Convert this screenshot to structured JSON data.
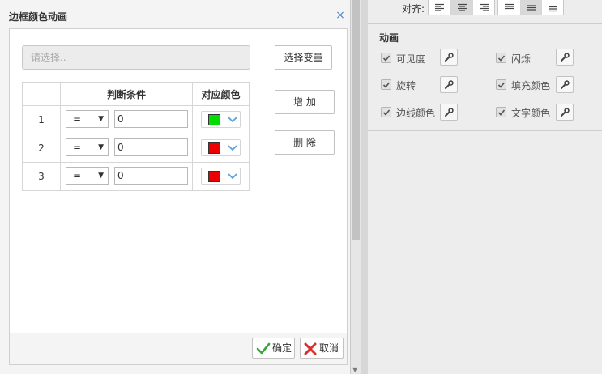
{
  "dialog": {
    "title": "边框颜色动画",
    "close_glyph": "×",
    "variable_placeholder": "请选择..",
    "select_variable_label": "选择变量",
    "add_label": "增 加",
    "delete_label": "删 除",
    "table": {
      "headers": [
        "",
        "判断条件",
        "对应颜色"
      ],
      "rows": [
        {
          "index": "1",
          "operator": "=",
          "value": "0",
          "color": "#00dd00"
        },
        {
          "index": "2",
          "operator": "=",
          "value": "0",
          "color": "#ee0000"
        },
        {
          "index": "3",
          "operator": "=",
          "value": "0",
          "color": "#ee0000"
        }
      ]
    },
    "ok_label": "确定",
    "cancel_label": "取消"
  },
  "panel": {
    "align_label": "对齐:",
    "animation_title": "动画",
    "items": [
      {
        "label": "可见度",
        "checked": true
      },
      {
        "label": "闪烁",
        "checked": true
      },
      {
        "label": "旋转",
        "checked": true
      },
      {
        "label": "填充颜色",
        "checked": true
      },
      {
        "label": "边线颜色",
        "checked": true
      },
      {
        "label": "文字颜色",
        "checked": true
      }
    ]
  },
  "colors": {
    "accent": "#4a8bd0",
    "ok_icon": "#3aa53a",
    "cancel_icon": "#d9302c"
  }
}
